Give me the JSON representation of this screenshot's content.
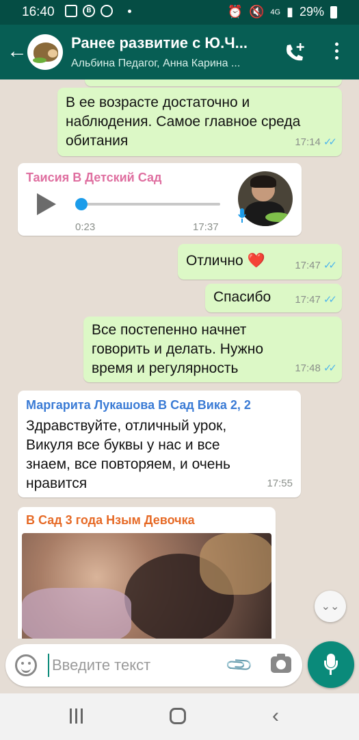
{
  "status_bar": {
    "time": "16:40",
    "battery": "29%",
    "network": "4G"
  },
  "header": {
    "title": "Ранее развитие с Ю.Ч...",
    "subtitle": "Альбина Педагог, Анна Карина ..."
  },
  "messages": {
    "m1": {
      "text": "В ее возрасте достаточно и\nнаблюдения.  Самое главное среда\nобитания",
      "time": "17:14"
    },
    "voice": {
      "sender": "Таисия В Детский Сад",
      "duration": "0:23",
      "time": "17:37",
      "progress": 0.0
    },
    "m2": {
      "text": "Отлично ❤️",
      "time": "17:47"
    },
    "m3": {
      "text": "Спасибо",
      "time": "17:47"
    },
    "m4": {
      "text": "Все постепенно начнет\nговорить и делать.  Нужно\nвремя и регулярность",
      "time": "17:48"
    },
    "m5": {
      "sender": "Маргарита Лукашова В Сад Вика 2, 2",
      "text": "Здравствуйте, отличный урок,\nВикуля все буквы у нас и все\nзнаем, все повторяем, и очень\nнравится",
      "time": "17:55"
    },
    "photo": {
      "sender": "В Сад 3 года Нзым Девочка"
    }
  },
  "composer": {
    "placeholder": "Введите текст"
  },
  "icons": {
    "back": "arrow-left-icon",
    "call": "add-call-icon",
    "menu": "more-vert-icon",
    "emoji": "emoji-icon",
    "attach": "paperclip-icon",
    "camera": "camera-icon",
    "mic": "microphone-icon",
    "scroll": "chevron-down-icon"
  },
  "colors": {
    "header": "#075e54",
    "outgoing_bubble": "#dcf8c6",
    "read_ticks": "#4fb6ec",
    "accent": "#0a8a7a"
  }
}
